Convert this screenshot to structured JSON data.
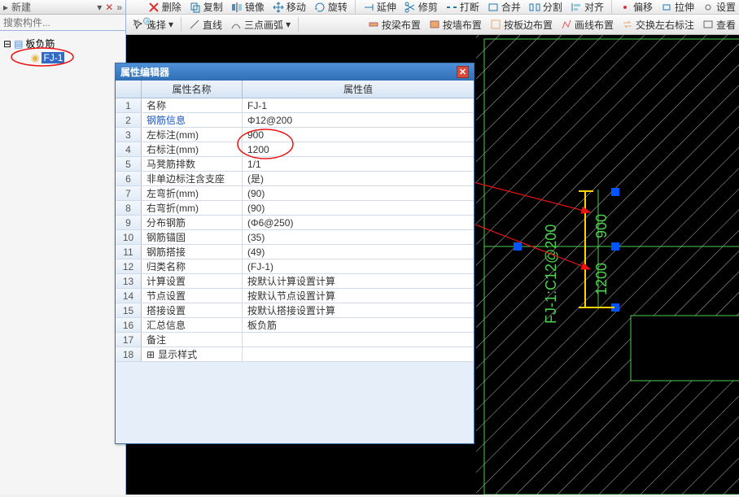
{
  "toolbar_top": {
    "new": "新建",
    "delete": "删除",
    "copy": "复制",
    "mirror": "镜像",
    "move": "移动",
    "rotate": "旋转",
    "extend": "延伸",
    "trim": "修剪",
    "break": "打断",
    "merge": "合并",
    "split": "分割",
    "align": "对齐",
    "offset": "偏移",
    "stretch": "拉伸",
    "settings": "设置"
  },
  "toolbar_mid": {
    "select": "选择",
    "line": "直线",
    "arc3": "三点画弧",
    "by_beam": "按梁布置",
    "by_wall": "按墙布置",
    "by_slab_edge": "按板边布置",
    "draw_line": "画线布置",
    "swap_lr": "交换左右标注",
    "view": "查看"
  },
  "left": {
    "title_drop": "新建",
    "search_placeholder": "搜索构件...",
    "root": "板负筋",
    "child": "FJ-1"
  },
  "prop": {
    "title": "属性编辑器",
    "col_name": "属性名称",
    "col_value": "属性值",
    "rows": [
      {
        "n": "1",
        "name": "名称",
        "value": "FJ-1",
        "blue": false
      },
      {
        "n": "2",
        "name": "钢筋信息",
        "value": "Φ12@200",
        "blue": true
      },
      {
        "n": "3",
        "name": "左标注(mm)",
        "value": "900",
        "blue": false
      },
      {
        "n": "4",
        "name": "右标注(mm)",
        "value": "1200",
        "blue": false
      },
      {
        "n": "5",
        "name": "马凳筋排数",
        "value": "1/1",
        "blue": false
      },
      {
        "n": "6",
        "name": "非单边标注含支座",
        "value": "(是)",
        "blue": false
      },
      {
        "n": "7",
        "name": "左弯折(mm)",
        "value": "(90)",
        "blue": false
      },
      {
        "n": "8",
        "name": "右弯折(mm)",
        "value": "(90)",
        "blue": false
      },
      {
        "n": "9",
        "name": "分布钢筋",
        "value": "(Φ6@250)",
        "blue": false
      },
      {
        "n": "10",
        "name": "钢筋锚固",
        "value": "(35)",
        "blue": false
      },
      {
        "n": "11",
        "name": "钢筋搭接",
        "value": "(49)",
        "blue": false
      },
      {
        "n": "12",
        "name": "归类名称",
        "value": "(FJ-1)",
        "blue": false
      },
      {
        "n": "13",
        "name": "计算设置",
        "value": "按默认计算设置计算",
        "blue": false
      },
      {
        "n": "14",
        "name": "节点设置",
        "value": "按默认节点设置计算",
        "blue": false
      },
      {
        "n": "15",
        "name": "搭接设置",
        "value": "按默认搭接设置计算",
        "blue": false
      },
      {
        "n": "16",
        "name": "汇总信息",
        "value": "板负筋",
        "blue": false
      },
      {
        "n": "17",
        "name": "备注",
        "value": "",
        "blue": false
      },
      {
        "n": "18",
        "name": "显示样式",
        "value": "",
        "blue": false,
        "expand": true
      }
    ]
  },
  "canvas": {
    "rebar_label": "FJ-1:C12@200",
    "dim_top": "900",
    "dim_bot": "1200"
  }
}
